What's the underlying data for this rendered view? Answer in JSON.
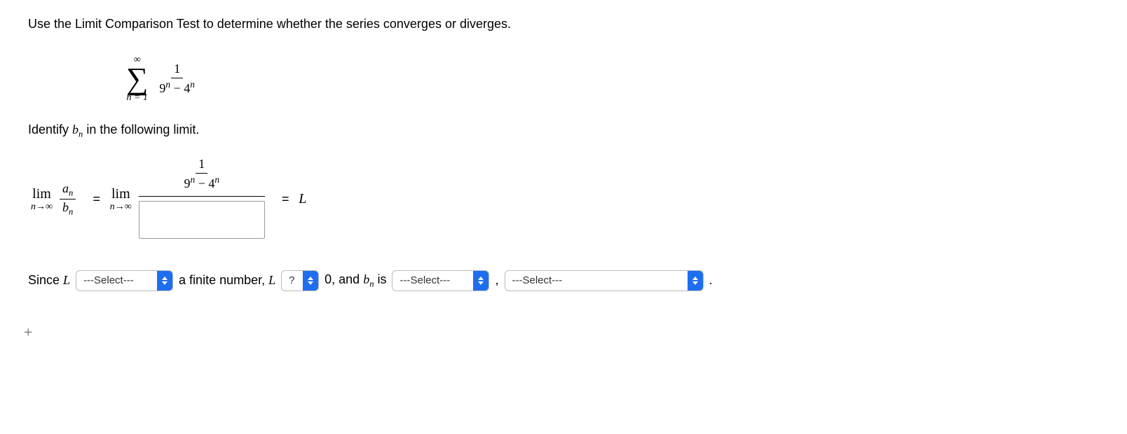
{
  "question": {
    "prompt": "Use the Limit Comparison Test to determine whether the series converges or diverges.",
    "series": {
      "sum_top": "∞",
      "sum_bottom": "n = 1",
      "frac_num": "1",
      "term_base1": "9",
      "term_exp1": "n",
      "term_minus": " − ",
      "term_base2": "4",
      "term_exp2": "n"
    },
    "identify_line_prefix": "Identify ",
    "identify_var": "b",
    "identify_sub": "n",
    "identify_line_suffix": " in the following limit.",
    "limit": {
      "lim_word": "lim",
      "lim_sub": "n→∞",
      "an_over_bn_top": "a",
      "an_over_bn_top_sub": "n",
      "an_over_bn_bot": "b",
      "an_over_bn_bot_sub": "n",
      "equals": "=",
      "rhs_var": "L"
    },
    "sentence": {
      "since": "Since ",
      "L": "L",
      "middle1": " a finite number, ",
      "L2": "L",
      "zero_text": " 0, and ",
      "bn_b": "b",
      "bn_n": "n",
      "is_text": " is",
      "comma": ",",
      "period": "."
    }
  },
  "selects": {
    "placeholder": "---Select---",
    "question_mark": "?"
  },
  "plus_label": "+"
}
